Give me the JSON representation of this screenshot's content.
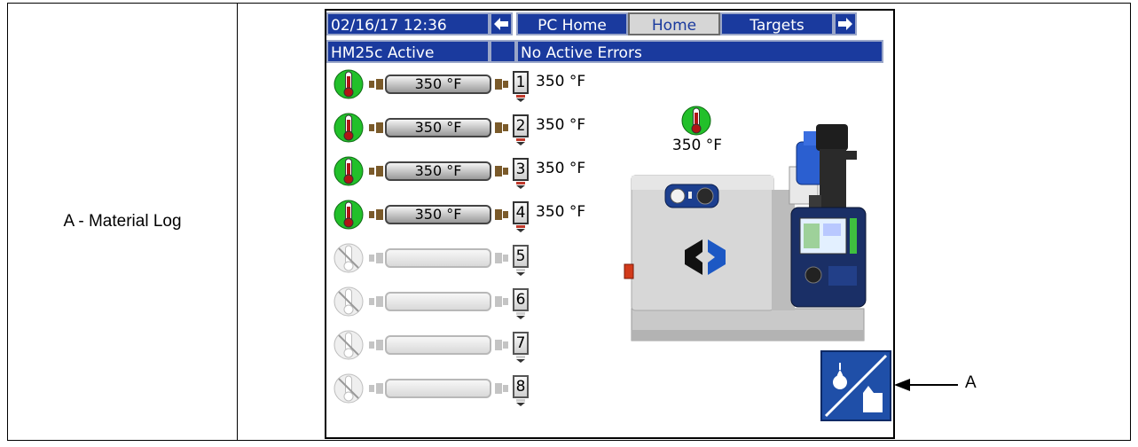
{
  "legend": {
    "text": "A - Material Log"
  },
  "topbar": {
    "datetime": "02/16/17 12:36",
    "tabs": [
      "PC Home",
      "Home",
      "Targets"
    ],
    "active_tab": "Home"
  },
  "statusbar": {
    "system": "HM25c Active",
    "errors": "No Active Errors"
  },
  "hoses": [
    {
      "number": "1",
      "setpoint": "350 °F",
      "actual": "350 °F",
      "active": true
    },
    {
      "number": "2",
      "setpoint": "350 °F",
      "actual": "350 °F",
      "active": true
    },
    {
      "number": "3",
      "setpoint": "350 °F",
      "actual": "350 °F",
      "active": true
    },
    {
      "number": "4",
      "setpoint": "350 °F",
      "actual": "350 °F",
      "active": true
    },
    {
      "number": "5",
      "setpoint": "",
      "actual": "",
      "active": false
    },
    {
      "number": "6",
      "setpoint": "",
      "actual": "",
      "active": false
    },
    {
      "number": "7",
      "setpoint": "",
      "actual": "",
      "active": false
    },
    {
      "number": "8",
      "setpoint": "",
      "actual": "",
      "active": false
    }
  ],
  "tank": {
    "temperature": "350 °F"
  },
  "material_log_button": {
    "icon": "material-log-icon"
  },
  "callout": {
    "label": "A"
  },
  "colors": {
    "header_blue": "#1a3a9e",
    "gauge_green": "#22c02a",
    "gauge_red": "#b01515",
    "button_blue": "#1f4fa8"
  }
}
